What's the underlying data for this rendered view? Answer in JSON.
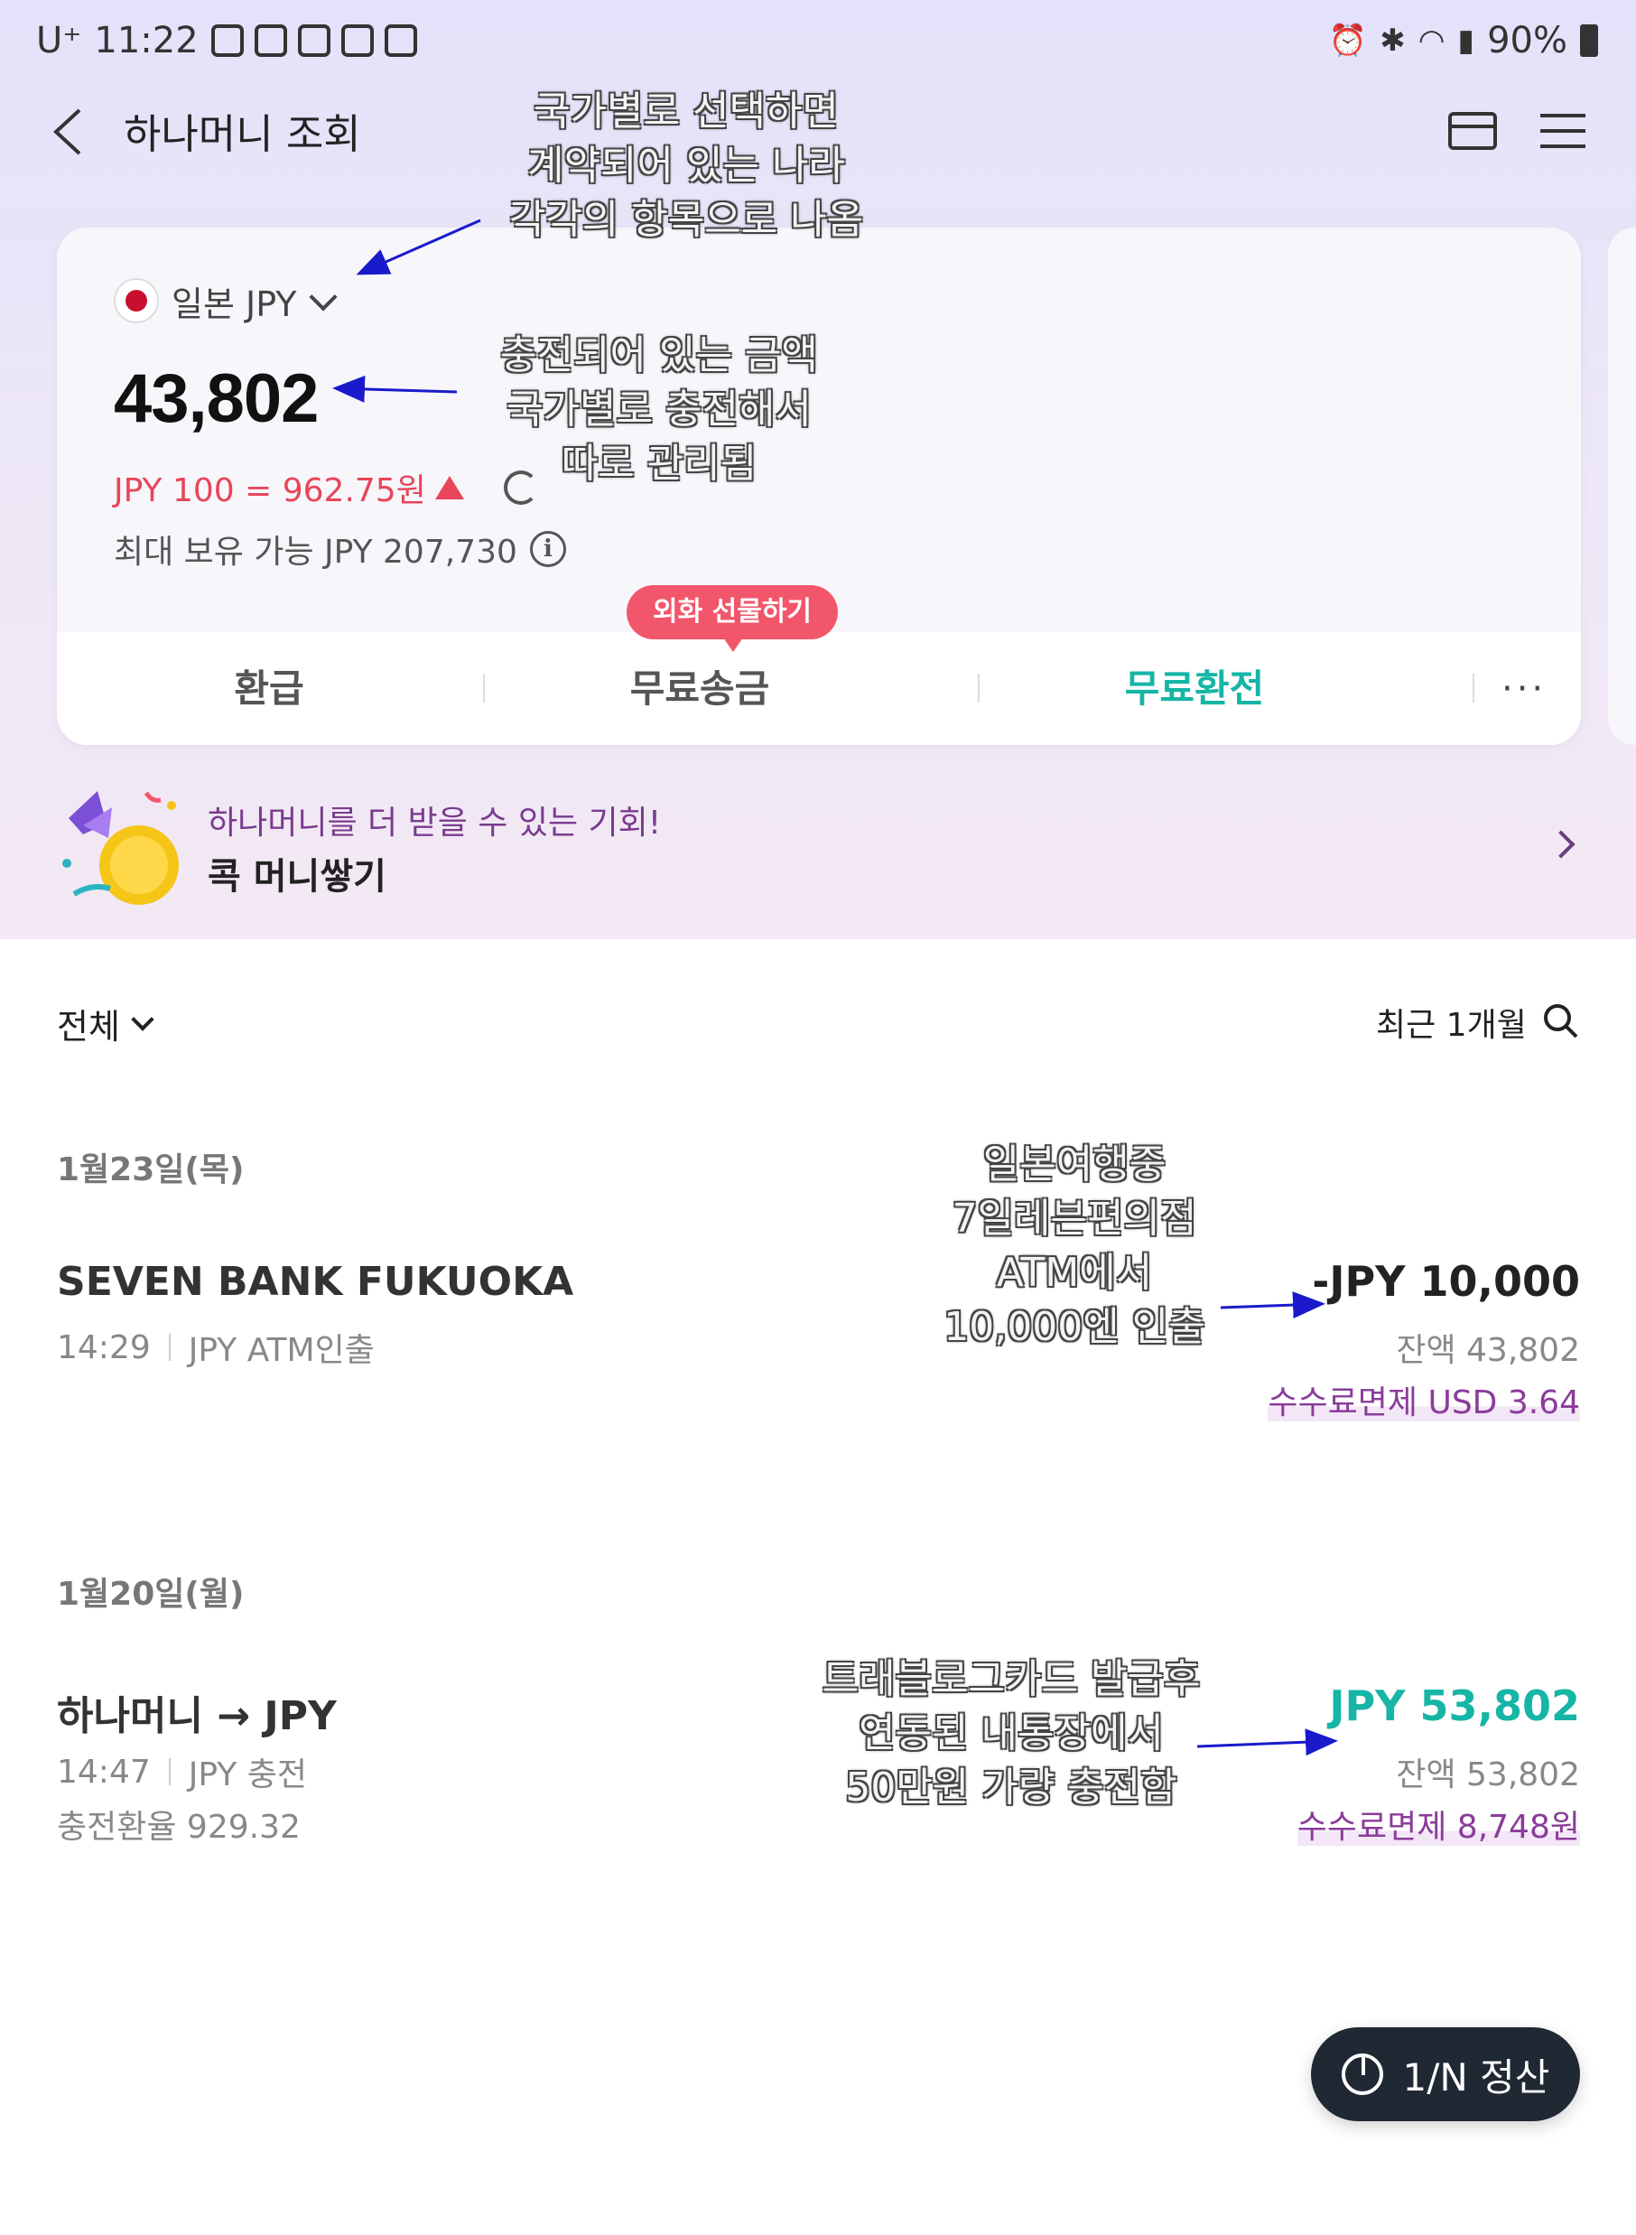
{
  "status_bar": {
    "carrier": "U⁺",
    "time": "11:22",
    "battery": "90%"
  },
  "header": {
    "title": "하나머니 조회"
  },
  "card": {
    "currency": "일본 JPY",
    "balance": "43,802",
    "rate": "JPY 100 = 962.75원",
    "max_hold": "최대 보유 가능 JPY 207,730",
    "info_glyph": "i",
    "badge": "외화 선물하기",
    "actions": [
      "환급",
      "무료송금",
      "무료환전"
    ],
    "more_glyph": "···"
  },
  "promo": {
    "subtitle": "하나머니를 더 받을 수 있는 기회!",
    "title": "콕 머니쌓기"
  },
  "filter": {
    "all": "전체",
    "period": "최근 1개월"
  },
  "transactions": [
    {
      "date": "1월23일(목)",
      "title": "SEVEN BANK FUKUOKA",
      "time": "14:29",
      "kind": "JPY ATM인출",
      "amount": "-JPY 10,000",
      "balance": "잔액 43,802",
      "fee": "수수료면제 USD 3.64"
    },
    {
      "date": "1월20일(월)",
      "title": "하나머니 → JPY",
      "time": "14:47",
      "kind": "JPY 충전",
      "sub": "충전환율 929.32",
      "amount": "JPY 53,802",
      "balance": "잔액 53,802",
      "fee": "수수료면제 8,748원"
    }
  ],
  "annotations": {
    "country": "국가별로 선택하면\n계약되어 있는 나라\n각각의 항목으로 나옴",
    "balance": "충전되어 있는 금액\n국가별로 충전해서\n따로 관리됨",
    "atm": "일본여행중\n7일레븐편의점\nATM에서\n10,000엔 인출",
    "charge": "트래블로그카드 발급후\n연동된 내통장에서\n50만원 가량 충전함"
  },
  "settle_button": "1/N 정산",
  "colors": {
    "teal": "#16b5a6",
    "rate_red": "#e8455a",
    "fee_purple": "#8a3c9a",
    "badge": "#f2566b"
  }
}
